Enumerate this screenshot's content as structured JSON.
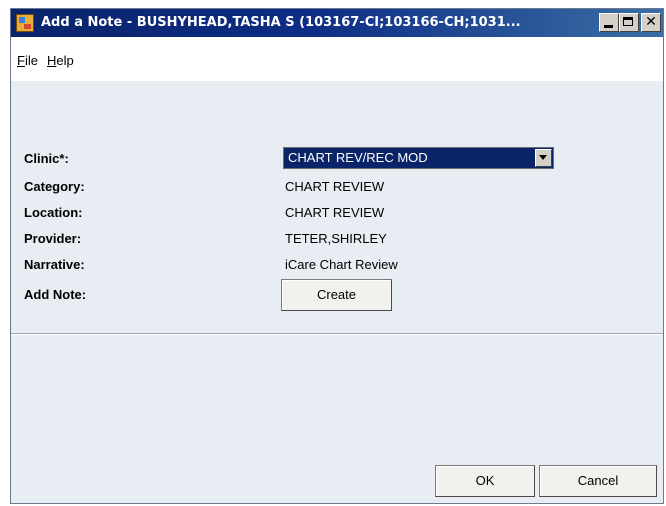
{
  "window": {
    "title": "Add a Note - BUSHYHEAD,TASHA S (103167-CI;103166-CH;1031...",
    "icon": "app-icon"
  },
  "menu": {
    "file_prefix": "",
    "file_underlined": "F",
    "file_rest": "ile",
    "help_underlined": "H",
    "help_rest": "elp"
  },
  "form": {
    "clinic_label": "Clinic*:",
    "clinic_value": "CHART REV/REC MOD",
    "category_label": "Category:",
    "category_value": "CHART REVIEW",
    "location_label": "Location:",
    "location_value": "CHART REVIEW",
    "provider_label": "Provider:",
    "provider_value": "TETER,SHIRLEY",
    "narrative_label": "Narrative:",
    "narrative_value": "iCare Chart Review",
    "add_note_label": "Add Note:",
    "create_button": "Create"
  },
  "buttons": {
    "ok": "OK",
    "cancel": "Cancel"
  },
  "colors": {
    "title_bar": "#0a246a",
    "client_background": "#e8edf3",
    "selection": "#0a246a"
  }
}
